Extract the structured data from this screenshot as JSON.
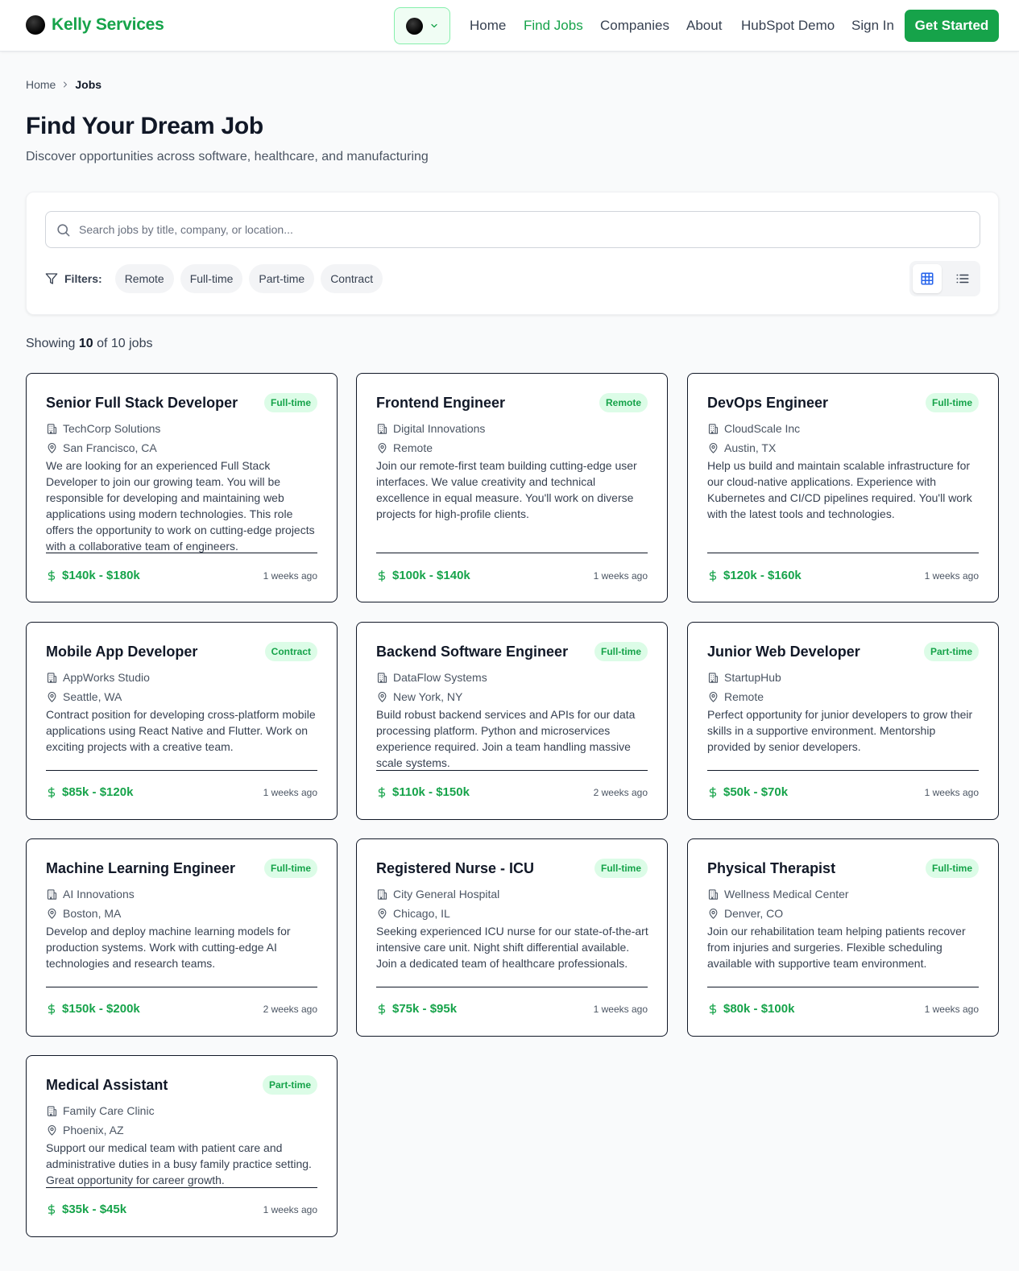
{
  "header": {
    "brand": "Kelly Services",
    "nav": [
      {
        "label": "Home"
      },
      {
        "label": "Find Jobs",
        "active": true
      },
      {
        "label": "Companies"
      },
      {
        "label": "About"
      },
      {
        "label": "HubSpot Demo"
      },
      {
        "label": "Sign In"
      }
    ],
    "cta": "Get Started"
  },
  "breadcrumb": {
    "home": "Home",
    "current": "Jobs"
  },
  "page": {
    "title": "Find Your Dream Job",
    "subtitle": "Discover opportunities across software, healthcare, and manufacturing"
  },
  "search": {
    "placeholder": "Search jobs by title, company, or location..."
  },
  "filters": {
    "label": "Filters:",
    "chips": [
      "Remote",
      "Full-time",
      "Part-time",
      "Contract"
    ]
  },
  "results": {
    "prefix": "Showing",
    "shown": "10",
    "suffix": "of 10 jobs"
  },
  "colors": {
    "accent": "#16a34a",
    "badge_bg": "#dcfce7",
    "view_active": "#2563eb"
  },
  "icons": [
    "building-icon",
    "map-pin-icon",
    "dollar-icon",
    "search-icon",
    "filter-icon",
    "grid-view-icon",
    "list-view-icon",
    "chevron-down-icon",
    "chevron-right-icon"
  ],
  "jobs": [
    {
      "title": "Senior Full Stack Developer",
      "type": "Full-time",
      "company": "TechCorp Solutions",
      "location": "San Francisco, CA",
      "description": "We are looking for an experienced Full Stack Developer to join our growing team. You will be responsible for developing and maintaining web applications using modern technologies. This role offers the opportunity to work on cutting-edge projects with a collaborative team of engineers.",
      "salary": "$140k - $180k",
      "posted": "1 weeks ago"
    },
    {
      "title": "Frontend Engineer",
      "type": "Remote",
      "company": "Digital Innovations",
      "location": "Remote",
      "description": "Join our remote-first team building cutting-edge user interfaces. We value creativity and technical excellence in equal measure. You'll work on diverse projects for high-profile clients.",
      "salary": "$100k - $140k",
      "posted": "1 weeks ago"
    },
    {
      "title": "DevOps Engineer",
      "type": "Full-time",
      "company": "CloudScale Inc",
      "location": "Austin, TX",
      "description": "Help us build and maintain scalable infrastructure for our cloud-native applications. Experience with Kubernetes and CI/CD pipelines required. You'll work with the latest tools and technologies.",
      "salary": "$120k - $160k",
      "posted": "1 weeks ago"
    },
    {
      "title": "Mobile App Developer",
      "type": "Contract",
      "company": "AppWorks Studio",
      "location": "Seattle, WA",
      "description": "Contract position for developing cross-platform mobile applications using React Native and Flutter. Work on exciting projects with a creative team.",
      "salary": "$85k - $120k",
      "posted": "1 weeks ago"
    },
    {
      "title": "Backend Software Engineer",
      "type": "Full-time",
      "company": "DataFlow Systems",
      "location": "New York, NY",
      "description": "Build robust backend services and APIs for our data processing platform. Python and microservices experience required. Join a team handling massive scale systems.",
      "salary": "$110k - $150k",
      "posted": "2 weeks ago"
    },
    {
      "title": "Junior Web Developer",
      "type": "Part-time",
      "company": "StartupHub",
      "location": "Remote",
      "description": "Perfect opportunity for junior developers to grow their skills in a supportive environment. Mentorship provided by senior developers.",
      "salary": "$50k - $70k",
      "posted": "1 weeks ago"
    },
    {
      "title": "Machine Learning Engineer",
      "type": "Full-time",
      "company": "AI Innovations",
      "location": "Boston, MA",
      "description": "Develop and deploy machine learning models for production systems. Work with cutting-edge AI technologies and research teams.",
      "salary": "$150k - $200k",
      "posted": "2 weeks ago"
    },
    {
      "title": "Registered Nurse - ICU",
      "type": "Full-time",
      "company": "City General Hospital",
      "location": "Chicago, IL",
      "description": "Seeking experienced ICU nurse for our state-of-the-art intensive care unit. Night shift differential available. Join a dedicated team of healthcare professionals.",
      "salary": "$75k - $95k",
      "posted": "1 weeks ago"
    },
    {
      "title": "Physical Therapist",
      "type": "Full-time",
      "company": "Wellness Medical Center",
      "location": "Denver, CO",
      "description": "Join our rehabilitation team helping patients recover from injuries and surgeries. Flexible scheduling available with supportive team environment.",
      "salary": "$80k - $100k",
      "posted": "1 weeks ago"
    },
    {
      "title": "Medical Assistant",
      "type": "Part-time",
      "company": "Family Care Clinic",
      "location": "Phoenix, AZ",
      "description": "Support our medical team with patient care and administrative duties in a busy family practice setting. Great opportunity for career growth.",
      "salary": "$35k - $45k",
      "posted": "1 weeks ago"
    }
  ]
}
